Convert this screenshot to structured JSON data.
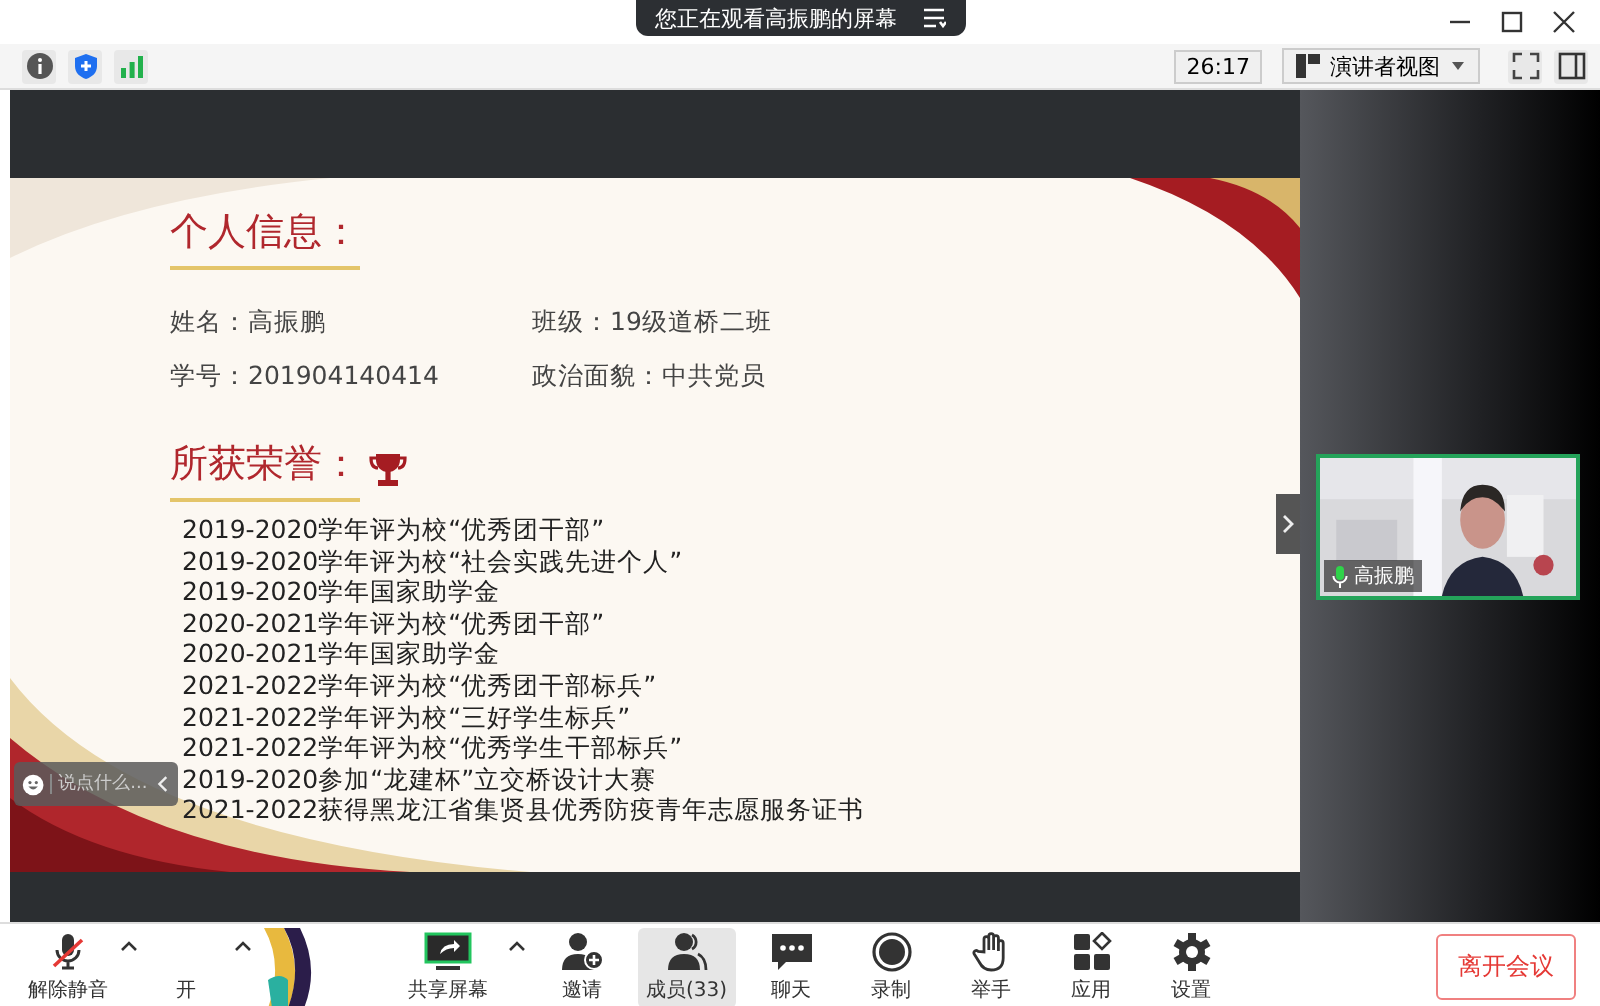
{
  "banner": {
    "text": "您正在观看高振鹏的屏幕"
  },
  "toolbar": {
    "timer": "26:17",
    "view_button": "演讲者视图"
  },
  "slide": {
    "info_title": "个人信息：",
    "info": [
      "姓名：高振鹏",
      "班级：19级道桥二班",
      "学号：201904140414",
      "政治面貌：中共党员"
    ],
    "honors_title": "所获荣誉：",
    "honors": [
      "2019-2020学年评为校“优秀团干部”",
      "2019-2020学年评为校“社会实践先进个人”",
      "2019-2020学年国家助学金",
      "2020-2021学年评为校“优秀团干部”",
      "2020-2021学年国家助学金",
      "2021-2022学年评为校“优秀团干部标兵”",
      "2021-2022学年评为校“三好学生标兵”",
      "2021-2022学年评为校“优秀学生干部标兵”",
      "2019-2020参加“龙建杯”立交桥设计大赛",
      "2021-2022获得黑龙江省集贤县优秀防疫青年志愿服务证书"
    ]
  },
  "chat_input": {
    "placeholder": "说点什么..."
  },
  "video_tile": {
    "name": "高振鹏"
  },
  "bottom_left": [
    {
      "kind": "mic",
      "label": "解除静音"
    },
    {
      "kind": "video",
      "label": "开"
    }
  ],
  "bottom_items": [
    {
      "kind": "share",
      "label": "共享屏幕",
      "selected": false
    },
    {
      "kind": "invite",
      "label": "邀请",
      "selected": false
    },
    {
      "kind": "members",
      "label": "成员(33)",
      "selected": true
    },
    {
      "kind": "chat",
      "label": "聊天",
      "selected": false
    },
    {
      "kind": "record",
      "label": "录制",
      "selected": false
    },
    {
      "kind": "hand",
      "label": "举手",
      "selected": false
    },
    {
      "kind": "apps",
      "label": "应用",
      "selected": false
    },
    {
      "kind": "settings",
      "label": "设置",
      "selected": false
    }
  ],
  "leave_button": "离开会议"
}
